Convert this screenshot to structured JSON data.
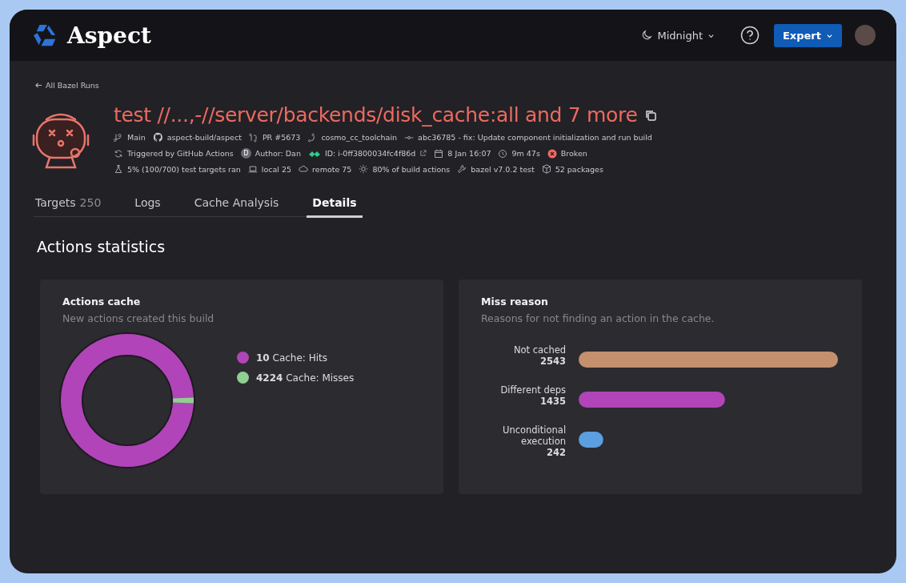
{
  "header": {
    "brand": "Aspect",
    "theme": "Midnight",
    "mode_button": "Expert"
  },
  "back_link": "All Bazel Runs",
  "run": {
    "title": "test //...,-//server/backends/disk_cache:all and 7 more",
    "meta_rows": [
      [
        {
          "text": "Main"
        },
        {
          "text": "aspect-build/aspect"
        },
        {
          "text": "PR #5673"
        },
        {
          "text": "cosmo_cc_toolchain"
        },
        {
          "text": "abc36785 - fix: Update component initialization and run build"
        }
      ],
      [
        {
          "text": "Triggered by GitHub Actions"
        },
        {
          "badge": "D",
          "text": "Author: Dan"
        },
        {
          "text": "ID: i-0ff3800034fc4f86d"
        },
        {
          "text": "8 Jan 16:07"
        },
        {
          "text": "9m 47s"
        },
        {
          "text": "Broken"
        }
      ],
      [
        {
          "text": "5% (100/700) test targets ran"
        },
        {
          "text": "local 25"
        },
        {
          "text": "remote 75"
        },
        {
          "text": "80% of build actions"
        },
        {
          "text": "bazel v7.0.2 test"
        },
        {
          "text": "52 packages"
        }
      ]
    ]
  },
  "tabs": [
    {
      "label": "Targets",
      "count": "250",
      "selected": false
    },
    {
      "label": "Logs",
      "selected": false
    },
    {
      "label": "Cache Analysis",
      "selected": false
    },
    {
      "label": "Details",
      "selected": true
    }
  ],
  "section_title": "Actions statistics",
  "actions_cache": {
    "title": "Actions cache",
    "subtitle": "New actions created this build",
    "legend": [
      {
        "text": "**10** Cache: Hits",
        "color": "#b144b8"
      },
      {
        "text": "**4224** Cache: Misses",
        "color": "#8fcf8f"
      }
    ]
  },
  "miss_reason": {
    "title": "Miss reason",
    "subtitle": "Reasons for not finding an action in the cache.",
    "chart_data": {
      "type": "bar",
      "orientation": "horizontal",
      "data_labels": true,
      "categories": [
        "Not cached",
        "Different deps",
        "Unconditional execution"
      ],
      "series": [
        {
          "color": "#c4906e",
          "values": [
            2543,
            null,
            null
          ]
        },
        {
          "color": "#b144b8",
          "values": [
            null,
            1435,
            null
          ]
        },
        {
          "color": "#5b9fe0",
          "values": [
            null,
            null,
            242
          ]
        }
      ]
    }
  }
}
